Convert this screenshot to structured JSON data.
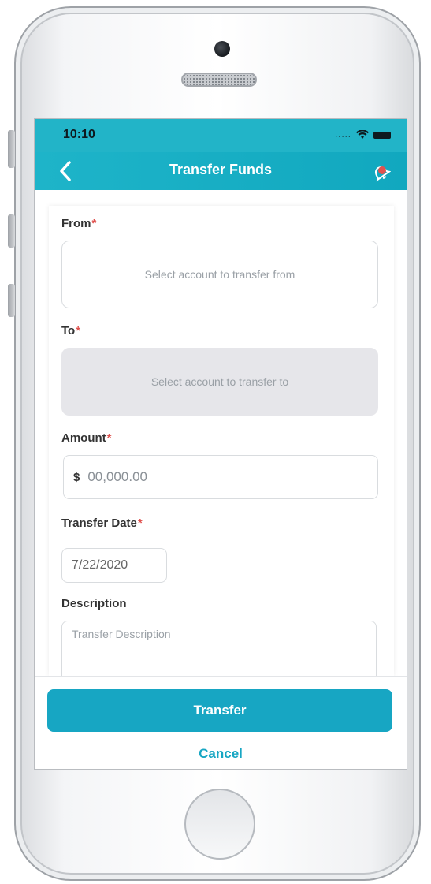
{
  "status_bar": {
    "time": "10:10",
    "signal_dots": "....."
  },
  "header": {
    "title": "Transfer Funds",
    "back_icon": "chevron-left-icon",
    "alert_icon": "bell-alert-icon"
  },
  "form": {
    "from": {
      "label": "From",
      "required_mark": "*",
      "placeholder": "Select account to transfer from"
    },
    "to": {
      "label": "To",
      "required_mark": "*",
      "placeholder": "Select account to transfer to"
    },
    "amount": {
      "label": "Amount",
      "required_mark": "*",
      "currency": "$",
      "placeholder": "00,000.00"
    },
    "transfer_date": {
      "label": "Transfer Date",
      "required_mark": "*",
      "value": "7/22/2020"
    },
    "description": {
      "label": "Description",
      "placeholder": "Transfer Description"
    }
  },
  "actions": {
    "transfer_label": "Transfer",
    "cancel_label": "Cancel"
  },
  "colors": {
    "accent": "#17a6c3",
    "header": "#1eb4c9",
    "required": "#e0524f"
  }
}
